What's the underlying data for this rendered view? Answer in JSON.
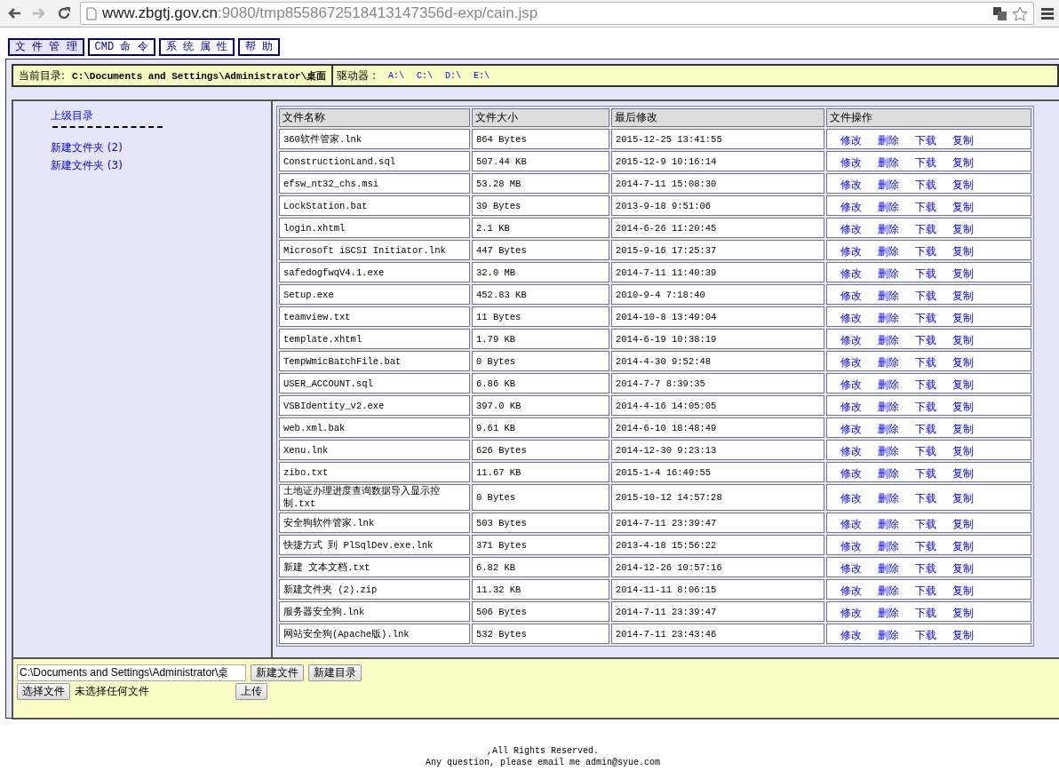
{
  "browser": {
    "url_host": "www.zbgtj.gov.cn",
    "url_rest": ":9080/tmp8558672518413147356d-exp/cain.jsp"
  },
  "tabs": [
    {
      "label": "文 件 管 理",
      "selected": true
    },
    {
      "label": "CMD 命 令",
      "selected": false
    },
    {
      "label": "系 统 属 性",
      "selected": false
    },
    {
      "label": "帮 助",
      "selected": false
    }
  ],
  "current_dir": {
    "label": "当前目录:",
    "path": "C:\\Documents and Settings\\Administrator\\桌面"
  },
  "drives": {
    "label": "驱动器 :",
    "items": [
      "A:\\",
      "C:\\",
      "D:\\",
      "E:\\"
    ]
  },
  "sidebar": {
    "parent_link": "上级目录",
    "folders": [
      "新建文件夹 (2)",
      "新建文件夹 (3)"
    ]
  },
  "table": {
    "columns": [
      "文件名称",
      "文件大小",
      "最后修改",
      "文件操作"
    ],
    "rows": [
      {
        "name": "360软件管家.lnk",
        "size": "864 Bytes",
        "modified": "2015-12-25 13:41:55",
        "actions": [
          "修改",
          "删除",
          "下载",
          "复制"
        ]
      },
      {
        "name": "ConstructionLand.sql",
        "size": "507.44 KB",
        "modified": "2015-12-9 10:16:14",
        "actions": [
          "修改",
          "删除",
          "下载",
          "复制"
        ]
      },
      {
        "name": "efsw_nt32_chs.msi",
        "size": "53.28 MB",
        "modified": "2014-7-11 15:08:30",
        "actions": [
          "修改",
          "删除",
          "下载",
          "复制"
        ]
      },
      {
        "name": "LockStation.bat",
        "size": "39 Bytes",
        "modified": "2013-9-18 9:51:06",
        "actions": [
          "修改",
          "删除",
          "下载",
          "复制"
        ]
      },
      {
        "name": "login.xhtml",
        "size": "2.1 KB",
        "modified": "2014-6-26 11:20:45",
        "actions": [
          "修改",
          "删除",
          "下载",
          "复制"
        ]
      },
      {
        "name": "Microsoft iSCSI Initiator.lnk",
        "size": "447 Bytes",
        "modified": "2015-9-16 17:25:37",
        "actions": [
          "修改",
          "删除",
          "下载",
          "复制"
        ]
      },
      {
        "name": "safedogfwqV4.1.exe",
        "size": "32.0 MB",
        "modified": "2014-7-11 11:40:39",
        "actions": [
          "修改",
          "删除",
          "下载",
          "复制"
        ]
      },
      {
        "name": "Setup.exe",
        "size": "452.83 KB",
        "modified": "2010-9-4 7:18:40",
        "actions": [
          "修改",
          "删除",
          "下载",
          "复制"
        ]
      },
      {
        "name": "teamview.txt",
        "size": "11 Bytes",
        "modified": "2014-10-8 13:49:04",
        "actions": [
          "修改",
          "删除",
          "下载",
          "复制"
        ]
      },
      {
        "name": "template.xhtml",
        "size": "1.79 KB",
        "modified": "2014-6-19 10:38:19",
        "actions": [
          "修改",
          "删除",
          "下载",
          "复制"
        ]
      },
      {
        "name": "TempWmicBatchFile.bat",
        "size": "0 Bytes",
        "modified": "2014-4-30 9:52:48",
        "actions": [
          "修改",
          "删除",
          "下载",
          "复制"
        ]
      },
      {
        "name": "USER_ACCOUNT.sql",
        "size": "6.86 KB",
        "modified": "2014-7-7 8:39:35",
        "actions": [
          "修改",
          "删除",
          "下载",
          "复制"
        ]
      },
      {
        "name": "VSBIdentity_v2.exe",
        "size": "397.0 KB",
        "modified": "2014-4-16 14:05:05",
        "actions": [
          "修改",
          "删除",
          "下载",
          "复制"
        ]
      },
      {
        "name": "web.xml.bak",
        "size": "9.61 KB",
        "modified": "2014-6-10 18:48:49",
        "actions": [
          "修改",
          "删除",
          "下载",
          "复制"
        ]
      },
      {
        "name": "Xenu.lnk",
        "size": "626 Bytes",
        "modified": "2014-12-30 9:23:13",
        "actions": [
          "修改",
          "删除",
          "下载",
          "复制"
        ]
      },
      {
        "name": "zibo.txt",
        "size": "11.67 KB",
        "modified": "2015-1-4 16:49:55",
        "actions": [
          "修改",
          "删除",
          "下载",
          "复制"
        ]
      },
      {
        "name": "土地证办理进度查询数据导入显示控制.txt",
        "size": "0 Bytes",
        "modified": "2015-10-12 14:57:28",
        "actions": [
          "修改",
          "删除",
          "下载",
          "复制"
        ]
      },
      {
        "name": "安全狗软件管家.lnk",
        "size": "503 Bytes",
        "modified": "2014-7-11 23:39:47",
        "actions": [
          "修改",
          "删除",
          "下载",
          "复制"
        ]
      },
      {
        "name": "快捷方式 到 PlSqlDev.exe.lnk",
        "size": "371 Bytes",
        "modified": "2013-4-18 15:56:22",
        "actions": [
          "修改",
          "删除",
          "下载",
          "复制"
        ]
      },
      {
        "name": "新建 文本文档.txt",
        "size": "6.82 KB",
        "modified": "2014-12-26 10:57:16",
        "actions": [
          "修改",
          "删除",
          "下载",
          "复制"
        ]
      },
      {
        "name": "新建文件夹 (2).zip",
        "size": "11.32 KB",
        "modified": "2014-11-11 8:06:15",
        "actions": [
          "修改",
          "删除",
          "下载",
          "复制"
        ]
      },
      {
        "name": "服务器安全狗.lnk",
        "size": "506 Bytes",
        "modified": "2014-7-11 23:39:47",
        "actions": [
          "修改",
          "删除",
          "下载",
          "复制"
        ]
      },
      {
        "name": "网站安全狗(Apache版).lnk",
        "size": "532 Bytes",
        "modified": "2014-7-11 23:43:46",
        "actions": [
          "修改",
          "删除",
          "下载",
          "复制"
        ]
      }
    ]
  },
  "bottom": {
    "path_value": "C:\\Documents and Settings\\Administrator\\桌",
    "new_file": "新建文件",
    "new_dir": "新建目录",
    "choose_file": "选择文件",
    "no_file": "未选择任何文件",
    "upload": "上传"
  },
  "footer": [
    ",All Rights Reserved.",
    "Any question, please email me admin@syue.com"
  ]
}
